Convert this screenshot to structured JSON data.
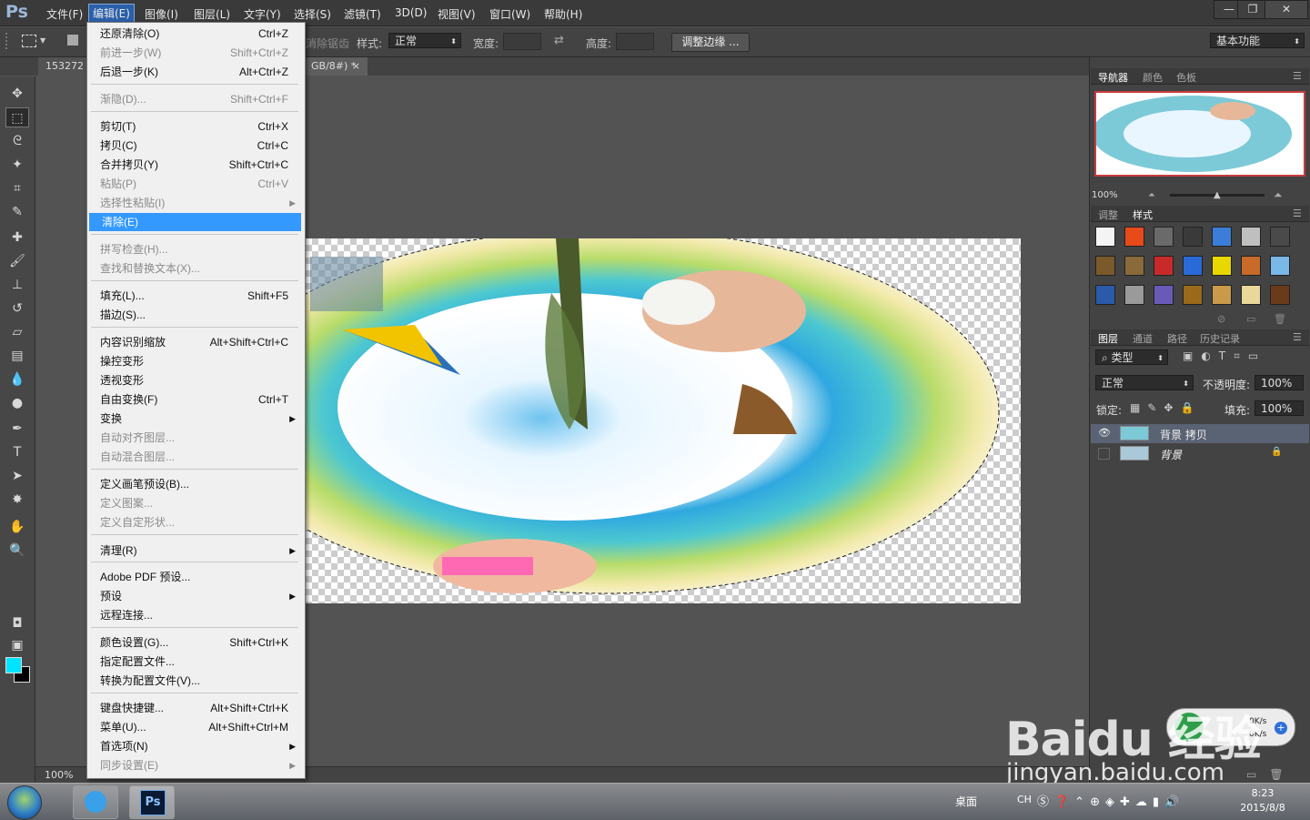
{
  "app": {
    "logo": "Ps"
  },
  "menubar": {
    "items": [
      "文件(F)",
      "编辑(E)",
      "图像(I)",
      "图层(L)",
      "文字(Y)",
      "选择(S)",
      "滤镜(T)",
      "3D(D)",
      "视图(V)",
      "窗口(W)",
      "帮助(H)"
    ],
    "active_index": 1
  },
  "window_controls": {
    "minimize": "—",
    "restore": "❐",
    "close": "✕"
  },
  "options": {
    "antialias_label": "消除锯齿",
    "style_label": "样式:",
    "style_value": "正常",
    "width_label": "宽度:",
    "height_label": "高度:",
    "refine_edge": "调整边缘 ...",
    "workspace": "基本功能"
  },
  "tabs": {
    "doc1": "153272",
    "doc2": "GB/8#) *",
    "close": "×"
  },
  "edit_menu": [
    {
      "label": "还原清除(O)",
      "shortcut": "Ctrl+Z",
      "disabled": false
    },
    {
      "label": "前进一步(W)",
      "shortcut": "Shift+Ctrl+Z",
      "disabled": true
    },
    {
      "label": "后退一步(K)",
      "shortcut": "Alt+Ctrl+Z",
      "disabled": false
    },
    {
      "label": "渐隐(D)...",
      "shortcut": "Shift+Ctrl+F",
      "disabled": true
    },
    {
      "label": "剪切(T)",
      "shortcut": "Ctrl+X",
      "disabled": false
    },
    {
      "label": "拷贝(C)",
      "shortcut": "Ctrl+C",
      "disabled": false
    },
    {
      "label": "合并拷贝(Y)",
      "shortcut": "Shift+Ctrl+C",
      "disabled": false
    },
    {
      "label": "粘贴(P)",
      "shortcut": "Ctrl+V",
      "disabled": true
    },
    {
      "label": "选择性粘贴(I)",
      "shortcut": "",
      "disabled": true,
      "submenu": true
    },
    {
      "label": "清除(E)",
      "shortcut": "",
      "disabled": false,
      "highlighted": true
    },
    {
      "label": "拼写检查(H)...",
      "shortcut": "",
      "disabled": true
    },
    {
      "label": "查找和替换文本(X)...",
      "shortcut": "",
      "disabled": true
    },
    {
      "label": "填充(L)...",
      "shortcut": "Shift+F5",
      "disabled": false
    },
    {
      "label": "描边(S)...",
      "shortcut": "",
      "disabled": false
    },
    {
      "label": "内容识别缩放",
      "shortcut": "Alt+Shift+Ctrl+C",
      "disabled": false
    },
    {
      "label": "操控变形",
      "shortcut": "",
      "disabled": false
    },
    {
      "label": "透视变形",
      "shortcut": "",
      "disabled": false
    },
    {
      "label": "自由变换(F)",
      "shortcut": "Ctrl+T",
      "disabled": false
    },
    {
      "label": "变换",
      "shortcut": "",
      "disabled": false,
      "submenu": true
    },
    {
      "label": "自动对齐图层...",
      "shortcut": "",
      "disabled": true
    },
    {
      "label": "自动混合图层...",
      "shortcut": "",
      "disabled": true
    },
    {
      "label": "定义画笔预设(B)...",
      "shortcut": "",
      "disabled": false
    },
    {
      "label": "定义图案...",
      "shortcut": "",
      "disabled": true
    },
    {
      "label": "定义自定形状...",
      "shortcut": "",
      "disabled": true
    },
    {
      "label": "清理(R)",
      "shortcut": "",
      "disabled": false,
      "submenu": true
    },
    {
      "label": "Adobe PDF 预设...",
      "shortcut": "",
      "disabled": false
    },
    {
      "label": "预设",
      "shortcut": "",
      "disabled": false,
      "submenu": true
    },
    {
      "label": "远程连接...",
      "shortcut": "",
      "disabled": false
    },
    {
      "label": "颜色设置(G)...",
      "shortcut": "Shift+Ctrl+K",
      "disabled": false
    },
    {
      "label": "指定配置文件...",
      "shortcut": "",
      "disabled": false
    },
    {
      "label": "转换为配置文件(V)...",
      "shortcut": "",
      "disabled": false
    },
    {
      "label": "键盘快捷键...",
      "shortcut": "Alt+Shift+Ctrl+K",
      "disabled": false
    },
    {
      "label": "菜单(U)...",
      "shortcut": "Alt+Shift+Ctrl+M",
      "disabled": false
    },
    {
      "label": "首选项(N)",
      "shortcut": "",
      "disabled": false,
      "submenu": true
    },
    {
      "label": "同步设置(E)",
      "shortcut": "",
      "disabled": true,
      "submenu": true
    }
  ],
  "right_panels": {
    "navigator_tabs": [
      "导航器",
      "颜色",
      "色板"
    ],
    "zoom": "100%",
    "adjust_tabs": [
      "调整",
      "样式"
    ],
    "layers_tabs": [
      "图层",
      "通道",
      "路径",
      "历史记录"
    ],
    "filter_kind": "类型",
    "blend_mode": "正常",
    "opacity_label": "不透明度:",
    "opacity_value": "100%",
    "lock_label": "锁定:",
    "fill_label": "填充:",
    "fill_value": "100%",
    "layers": [
      {
        "name": "背景 拷贝",
        "selected": true,
        "visible": true,
        "locked": false
      },
      {
        "name": "背景",
        "selected": false,
        "visible": false,
        "locked": true
      }
    ]
  },
  "status": {
    "zoom": "100%"
  },
  "taskbar": {
    "desktop_label": "桌面",
    "ime": "CH",
    "time": "8:23",
    "date": "2015/8/8"
  },
  "netmeter": {
    "up": "0K/s",
    "down": "0K/s"
  },
  "watermark": {
    "brand": "Baidu 经验",
    "url": "jingyan.baidu.com"
  },
  "colors": {
    "foreground": "#00e5ff",
    "background": "#000000",
    "highlight": "#3399ff"
  }
}
